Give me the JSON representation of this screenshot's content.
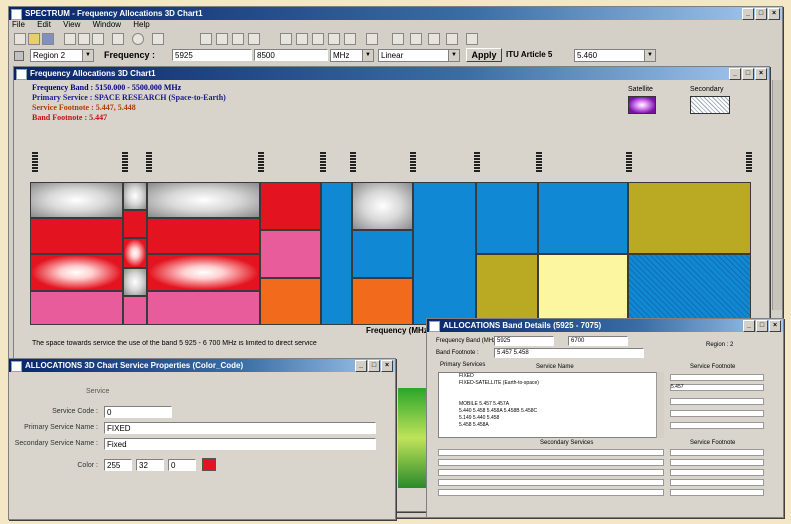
{
  "app": {
    "title": "SPECTRUM - Frequency Allocations 3D Chart1",
    "menu": [
      "File",
      "Edit",
      "View",
      "Window",
      "Help"
    ]
  },
  "toolbar": {
    "region_label": "Region 2",
    "frequency_label": "Frequency :",
    "freq_from": "5925",
    "freq_to": "8500",
    "unit": "MHz",
    "scale": "Linear",
    "apply_label": "Apply",
    "itu_label": "ITU Article 5",
    "itu_value": "5.460"
  },
  "chart_window": {
    "title": "Frequency Allocations 3D Chart1",
    "info": {
      "band": "Frequency Band : 5150.000 - 5500.000 MHz",
      "primary": "Primary Service : SPACE RESEARCH (Space-to-Earth)",
      "secondary": "Service Footnote : 5.447, 5.448",
      "footnote": "Band Footnote : 5.447"
    },
    "legend": {
      "satellite": "Satellite",
      "secondary": "Secondary"
    },
    "status": "The space towards service the use of the band 5 925 - 6 700 MHz is limited to direct service",
    "axis_label": "Frequency (MHz)",
    "colors": {
      "red": "#e3141f",
      "pink": "#e85c9c",
      "orange": "#f26a1b",
      "blue": "#1188d4",
      "olive": "#b9a923",
      "yellow": "#fdf6a1",
      "gray": "#9a9a9a"
    }
  },
  "service_window": {
    "title": "ALLOCATIONS 3D Chart Service Properties (Color_Code)",
    "heading": "Service",
    "service_code_label": "Service Code :",
    "service_code": "0",
    "primary_name_label": "Primary Service Name :",
    "primary_name": "FIXED",
    "secondary_name_label": "Secondary Service Name :",
    "secondary_name": "Fixed",
    "color_label": "Color :",
    "color_r": "255",
    "color_g": "32",
    "color_b": "0",
    "swatch": "#e3141f"
  },
  "band_window": {
    "title": "ALLOCATIONS Band Details (5925 - 7075)",
    "freq_band_label": "Frequency Band (MHz) :",
    "freq_from": "5925",
    "freq_to": "6700",
    "band_footnote_label": "Band Footnote :",
    "band_footnote": "5.457 5.458",
    "region_label": "Region :",
    "region_value": "2",
    "primary_services_tab": "Primary Services",
    "service_name_header": "Service Name",
    "service_footnote_header": "Service Footnote",
    "rows": [
      "FIXED",
      "FIXED-SATELLITE (Earth-to-space)",
      "",
      "",
      "MOBILE 5.457 5.457A",
      "5.440 5.458 5.458A 5.458B 5.458C",
      "5.149 5.440 5.458",
      "5.458 5.458A"
    ],
    "footnotes": [
      "",
      "5.457"
    ],
    "secondary_services_header": "Secondary Services",
    "secondary_footnote_header": "Service Footnote"
  }
}
